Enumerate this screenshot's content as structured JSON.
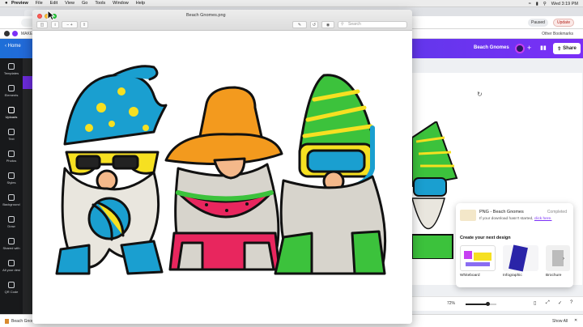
{
  "menubar": {
    "app": "Preview",
    "items": [
      "File",
      "Edit",
      "View",
      "Go",
      "Tools",
      "Window",
      "Help"
    ],
    "clock": "Wed 3:19 PM"
  },
  "browser": {
    "profile_paused": "Paused",
    "update_label": "Update",
    "bookmark_left": "MAKE",
    "bookmark_right": "Other Bookmarks"
  },
  "canva": {
    "home_label": "Home",
    "doc_title": "Beach Gnomes",
    "share_label": "Share",
    "sidebar": [
      "Templates",
      "Elements",
      "Uploads",
      "Text",
      "Photos",
      "Styles",
      "Background",
      "Draw",
      "Shared with",
      "All your desi",
      "QR Code"
    ],
    "zoom_label": "72%",
    "zoom_value": 0.72,
    "download_popup": {
      "title": "PNG - Beach Gnomes",
      "status": "Completed",
      "message": "If your download hasn't started,",
      "link": "click here.",
      "heading": "Create your next design",
      "templates": [
        "Whiteboard",
        "Infographic",
        "Brochure"
      ]
    },
    "download_bar": {
      "file": "Beach Gnomes",
      "show_all": "Show All"
    }
  },
  "preview": {
    "title": "Beach Gnomes.png",
    "search_placeholder": "Search"
  },
  "colors": {
    "canva_purple": "#7b2ff7",
    "canva_blue": "#1d6fd8",
    "gnome_blue": "#1a9fd0",
    "gnome_yellow": "#f6e021",
    "gnome_orange": "#f39a1e",
    "gnome_red": "#e8265e",
    "gnome_green": "#3cc23c"
  }
}
